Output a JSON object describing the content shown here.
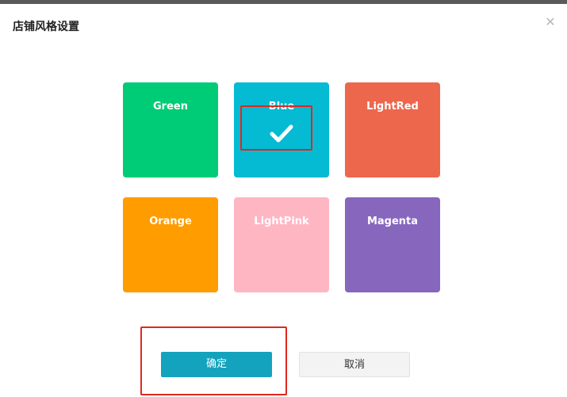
{
  "dialog": {
    "title": "店铺风格设置",
    "close_icon": "close-icon",
    "close_glyph": "✕"
  },
  "themes": [
    {
      "name": "Green",
      "color": "#00cc77",
      "selected": false
    },
    {
      "name": "Blue",
      "color": "#05bad3",
      "selected": true
    },
    {
      "name": "LightRed",
      "color": "#ed674d",
      "selected": false
    },
    {
      "name": "Orange",
      "color": "#ff9c00",
      "selected": false
    },
    {
      "name": "LightPink",
      "color": "#ffb6c3",
      "selected": false
    },
    {
      "name": "Magenta",
      "color": "#8667bd",
      "selected": false
    }
  ],
  "buttons": {
    "confirm_label": "确定",
    "cancel_label": "取消"
  },
  "colors": {
    "primary": "#14a3bd",
    "annotation_red": "#e0281d"
  }
}
